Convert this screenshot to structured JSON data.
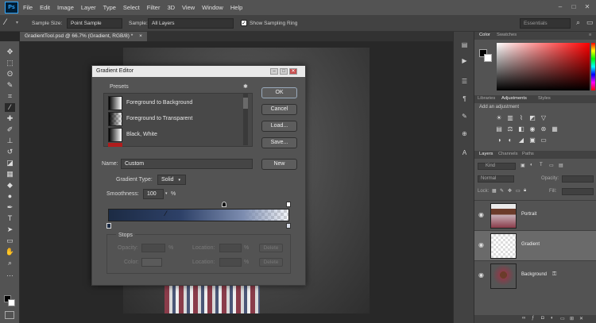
{
  "menubar": {
    "logo": "Ps",
    "items": [
      "File",
      "Edit",
      "Image",
      "Layer",
      "Type",
      "Select",
      "Filter",
      "3D",
      "View",
      "Window",
      "Help"
    ],
    "window_controls": [
      "–",
      "□",
      "✕"
    ]
  },
  "options": {
    "sample_size_label": "Sample Size:",
    "sample_size_value": "Point Sample",
    "sample_label": "Sample:",
    "sample_value": "All Layers",
    "sampling_ring_label": "Show Sampling Ring",
    "sampling_ring_checked": "✓",
    "workspace": "Essentials"
  },
  "document": {
    "tab_title": "GradientTool.psd @ 66.7% (Gradient, RGB/8) *",
    "tab_close": "×"
  },
  "dialog": {
    "title": "Gradient Editor",
    "presets_label": "Presets",
    "presets": [
      {
        "name": "Foreground to Background"
      },
      {
        "name": "Foreground to Transparent"
      },
      {
        "name": "Black, White"
      }
    ],
    "buttons": {
      "ok": "OK",
      "cancel": "Cancel",
      "load": "Load...",
      "save": "Save...",
      "new": "New"
    },
    "name_label": "Name:",
    "name_value": "Custom",
    "gradient_type_label": "Gradient Type:",
    "gradient_type_value": "Solid",
    "smoothness_label": "Smoothness:",
    "smoothness_value": "100",
    "smoothness_unit": "%",
    "stops_label": "Stops",
    "opacity_label": "Opacity:",
    "color_label": "Color:",
    "location_label": "Location:",
    "percent": "%",
    "delete_label": "Delete"
  },
  "panels": {
    "color_tabs": [
      "Color",
      "Swatches"
    ],
    "adjust_tabs": [
      "Libraries",
      "Adjustments",
      "Styles"
    ],
    "add_adjustment": "Add an adjustment",
    "layers_tabs": [
      "Layers",
      "Channels",
      "Paths"
    ],
    "kind_label": "Kind",
    "blend_mode": "Normal",
    "opacity_label": "Opacity:",
    "lock_label": "Lock:",
    "fill_label": "Fill:",
    "layers": [
      {
        "name": "Portrait"
      },
      {
        "name": "Gradient"
      },
      {
        "name": "Background"
      }
    ]
  },
  "colors": {
    "ui_dark": "#535353",
    "accent": "#31a8ff",
    "selected_layer": "#6a6a6a"
  }
}
